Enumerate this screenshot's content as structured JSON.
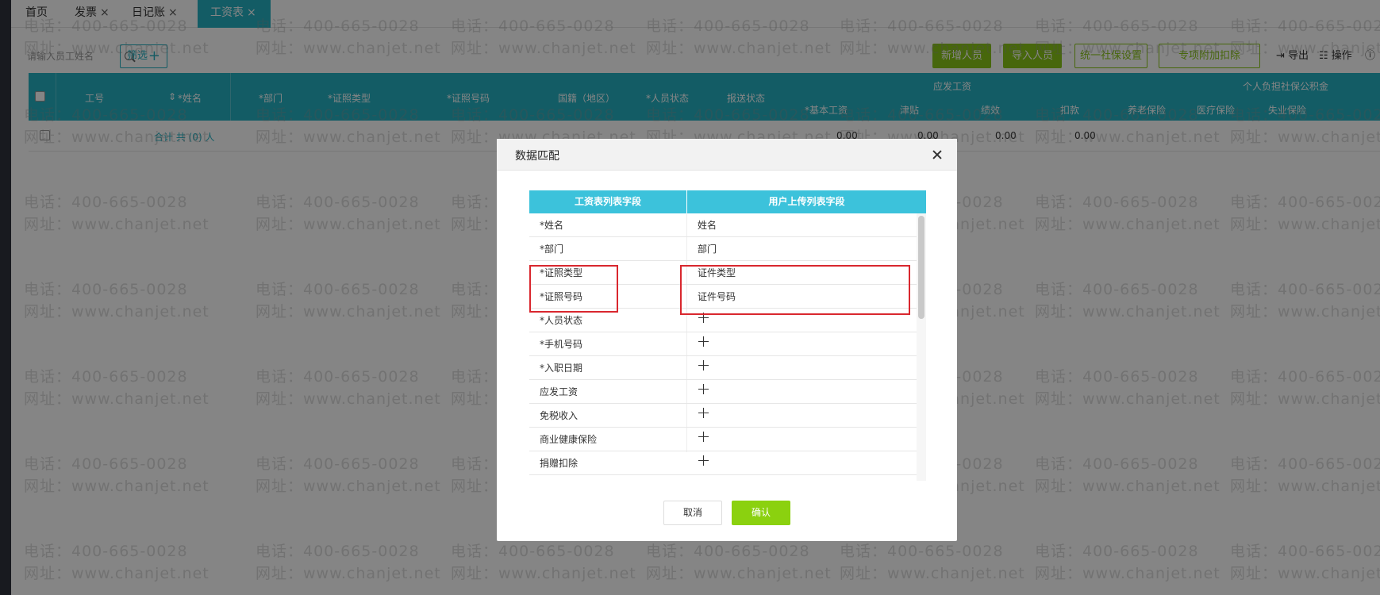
{
  "tabs": [
    {
      "label": "首页",
      "closable": false
    },
    {
      "label": "发票",
      "closable": true
    },
    {
      "label": "日记账",
      "closable": true
    },
    {
      "label": "工资表",
      "closable": true
    }
  ],
  "toolbar": {
    "search_placeholder": "请输入员工姓名",
    "filter_label": "筛选",
    "add_person": "新增人员",
    "import_person": "导入人员",
    "social_security": "统一社保设置",
    "special_deduction": "专项附加扣除",
    "export": "导出",
    "operation": "操作"
  },
  "table": {
    "headers": {
      "emp_no": "工号",
      "name": "*姓名",
      "dept": "*部门",
      "id_type": "*证照类型",
      "id_no": "*证照号码",
      "nationality": "国籍（地区）",
      "status": "*人员状态",
      "report_status": "报送状态",
      "payable_group": "应发工资",
      "base_salary": "*基本工资",
      "allowance": "津贴",
      "performance": "绩效",
      "deduction": "扣款",
      "personal_group": "个人负担社保公积金",
      "pension": "养老保险",
      "medical": "医疗保险",
      "unemployment": "失业保险"
    },
    "summary": {
      "label": "合计 共 (0) 人",
      "v1": "0.00",
      "v2": "0.00",
      "v3": "0.00",
      "v4": "0.00"
    }
  },
  "dialog": {
    "title": "数据匹配",
    "col_left": "工资表列表字段",
    "col_right": "用户上传列表字段",
    "rows": [
      {
        "left": "*姓名",
        "right": "姓名"
      },
      {
        "left": "*部门",
        "right": "部门"
      },
      {
        "left": "*证照类型",
        "right": "证件类型"
      },
      {
        "left": "*证照号码",
        "right": "证件号码"
      },
      {
        "left": "*人员状态",
        "right": ""
      },
      {
        "left": "*手机号码",
        "right": ""
      },
      {
        "left": "*入职日期",
        "right": ""
      },
      {
        "left": "应发工资",
        "right": ""
      },
      {
        "left": "免税收入",
        "right": ""
      },
      {
        "left": "商业健康保险",
        "right": ""
      },
      {
        "left": "捐赠扣除",
        "right": ""
      }
    ],
    "cancel": "取消",
    "confirm": "确认"
  },
  "watermark": {
    "phone": "电话：400-665-0028",
    "site": "网址：www.chanjet.net"
  },
  "colors": {
    "teal": "#25b1c2",
    "green": "#89c517",
    "highlight_red": "#d9272e"
  }
}
